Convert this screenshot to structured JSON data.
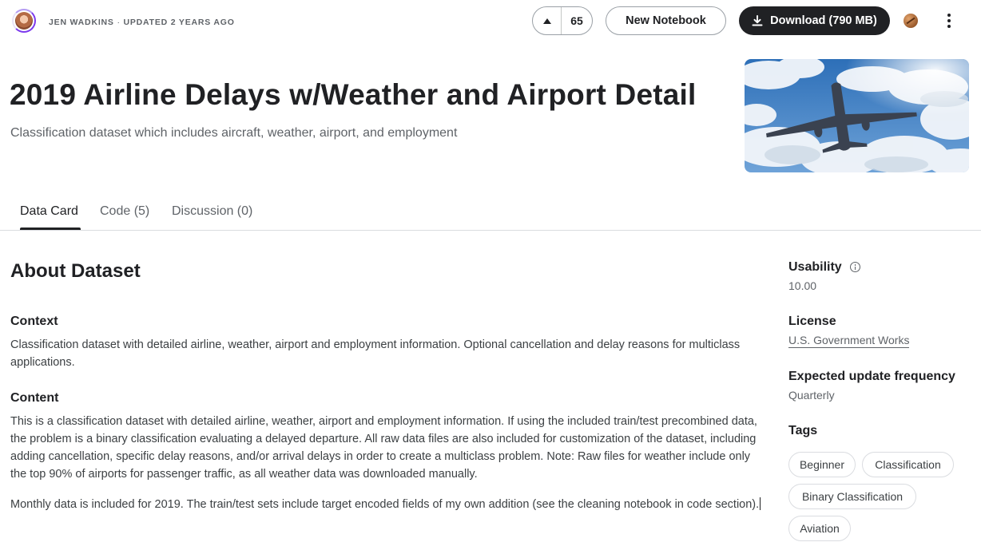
{
  "header": {
    "author": "JEN WADKINS",
    "separator": "·",
    "updated": "UPDATED 2 YEARS AGO",
    "vote_count": "65",
    "new_notebook_label": "New Notebook",
    "download_label": "Download (790 MB)"
  },
  "dataset": {
    "title": "2019 Airline Delays w/Weather and Airport Detail",
    "subtitle": "Classification dataset which includes aircraft, weather, airport, and employment"
  },
  "tabs": [
    {
      "label": "Data Card",
      "active": true
    },
    {
      "label": "Code (5)",
      "active": false
    },
    {
      "label": "Discussion (0)",
      "active": false
    }
  ],
  "about": {
    "heading": "About Dataset",
    "context_heading": "Context",
    "context_text": "Classification dataset with detailed airline, weather, airport and employment information. Optional cancellation and delay reasons for multiclass applications.",
    "content_heading": "Content",
    "content_text": "This is a classification dataset with detailed airline, weather, airport and employment information. If using the included train/test precombined data, the problem is a binary classification evaluating a delayed departure. All raw data files are also included for customization of the dataset, including adding cancellation, specific delay reasons, and/or arrival delays in order to create a multiclass problem. Note: Raw files for weather include only the top 90% of airports for passenger traffic, as all weather data was downloaded manually.",
    "monthly_text": "Monthly data is included for 2019. The train/test sets include target encoded fields of my own addition (see the cleaning notebook in code section)."
  },
  "sidebar": {
    "usability_label": "Usability",
    "usability_value": "10.00",
    "license_label": "License",
    "license_value": "U.S. Government Works",
    "update_label": "Expected update frequency",
    "update_value": "Quarterly",
    "tags_label": "Tags",
    "tags": [
      "Beginner",
      "Classification",
      "Binary Classification",
      "Aviation"
    ]
  },
  "colors": {
    "primary_dark": "#202124",
    "text_secondary": "#5f6368",
    "border": "#dadce0",
    "avatar_ring": "#7c3aed"
  },
  "icons": [
    "avatar",
    "upvote-arrow-icon",
    "download-icon",
    "profile-icon",
    "kebab-menu-icon",
    "info-icon"
  ]
}
